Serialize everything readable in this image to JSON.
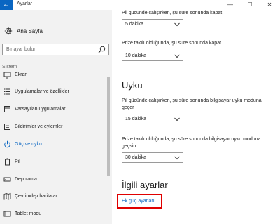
{
  "window": {
    "title": "Ayarlar",
    "back_glyph": "←",
    "minimize_glyph": "—",
    "maximize_glyph": "☐",
    "close_glyph": "✕"
  },
  "sidebar": {
    "home_label": "Ana Sayfa",
    "search_placeholder": "Bir ayar bulun",
    "section_label": "Sistem",
    "items": [
      {
        "label": "Ekran",
        "icon": "monitor-icon",
        "active": false
      },
      {
        "label": "Uygulamalar ve özellikler",
        "icon": "list-icon",
        "active": false
      },
      {
        "label": "Varsayılan uygulamalar",
        "icon": "default-apps-icon",
        "active": false
      },
      {
        "label": "Bildirimler ve eylemler",
        "icon": "notification-icon",
        "active": false
      },
      {
        "label": "Güç ve uyku",
        "icon": "power-icon",
        "active": true
      },
      {
        "label": "Pil",
        "icon": "battery-icon",
        "active": false
      },
      {
        "label": "Depolama",
        "icon": "storage-icon",
        "active": false
      },
      {
        "label": "Çevrimdışı haritalar",
        "icon": "map-icon",
        "active": false
      },
      {
        "label": "Tablet modu",
        "icon": "tablet-icon",
        "active": false
      }
    ]
  },
  "screen": {
    "battery_label": "Pil gücünde çalışırken, şu süre sonunda kapat",
    "battery_value": "5 dakika",
    "plugged_label": "Prize takılı olduğunda, şu süre sonunda kapat",
    "plugged_value": "10 dakika"
  },
  "sleep": {
    "heading": "Uyku",
    "battery_label_1": "Pil gücünde çalışırken, şu süre sonunda bilgisayar uyku moduna",
    "battery_label_2": "geçer",
    "battery_value": "15 dakika",
    "plugged_label_1": "Prize takılı olduğunda, şu süre sonunda bilgisayar uyku moduna",
    "plugged_label_2": "geçsin",
    "plugged_value": "30 dakika"
  },
  "related": {
    "heading": "İlgili ayarlar",
    "link": "Ek güç ayarları"
  },
  "colors": {
    "accent": "#0a66c2",
    "highlight": "#e00000",
    "sidebar_bg": "#f2f2f2"
  }
}
